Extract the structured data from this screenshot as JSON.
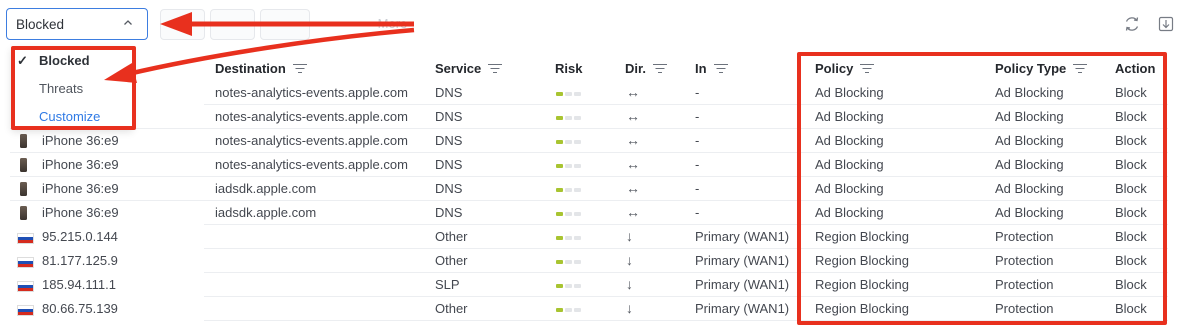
{
  "toolbar": {
    "filter_value": "Blocked",
    "ghost_text": "· · · · ·  · More ·",
    "icons": [
      "refresh-icon",
      "download-icon"
    ]
  },
  "dropdown": {
    "items": [
      {
        "label": "Blocked",
        "checked": true
      },
      {
        "label": "Threats",
        "checked": false
      },
      {
        "label": "Customize",
        "checked": false
      }
    ]
  },
  "columns": {
    "destination": "Destination",
    "service": "Service",
    "risk": "Risk",
    "dir": "Dir.",
    "in": "In",
    "policy": "Policy",
    "policy_type": "Policy Type",
    "action": "Action"
  },
  "rows": [
    {
      "source": "",
      "source_kind": "none",
      "destination": "notes-analytics-events.apple.com",
      "service": "DNS",
      "risk": 1,
      "dir": "↔",
      "in": "-",
      "policy": "Ad Blocking",
      "policy_type": "Ad Blocking",
      "action": "Block"
    },
    {
      "source": "",
      "source_kind": "none",
      "destination": "notes-analytics-events.apple.com",
      "service": "DNS",
      "risk": 1,
      "dir": "↔",
      "in": "-",
      "policy": "Ad Blocking",
      "policy_type": "Ad Blocking",
      "action": "Block"
    },
    {
      "source": "iPhone 36:e9",
      "source_kind": "device",
      "destination": "notes-analytics-events.apple.com",
      "service": "DNS",
      "risk": 1,
      "dir": "↔",
      "in": "-",
      "policy": "Ad Blocking",
      "policy_type": "Ad Blocking",
      "action": "Block"
    },
    {
      "source": "iPhone 36:e9",
      "source_kind": "device",
      "destination": "notes-analytics-events.apple.com",
      "service": "DNS",
      "risk": 1,
      "dir": "↔",
      "in": "-",
      "policy": "Ad Blocking",
      "policy_type": "Ad Blocking",
      "action": "Block"
    },
    {
      "source": "iPhone 36:e9",
      "source_kind": "device",
      "destination": "iadsdk.apple.com",
      "service": "DNS",
      "risk": 1,
      "dir": "↔",
      "in": "-",
      "policy": "Ad Blocking",
      "policy_type": "Ad Blocking",
      "action": "Block"
    },
    {
      "source": "iPhone 36:e9",
      "source_kind": "device",
      "destination": "iadsdk.apple.com",
      "service": "DNS",
      "risk": 1,
      "dir": "↔",
      "in": "-",
      "policy": "Ad Blocking",
      "policy_type": "Ad Blocking",
      "action": "Block"
    },
    {
      "source": "95.215.0.144",
      "source_kind": "flag-ru",
      "destination": "",
      "service": "Other",
      "risk": 1,
      "dir": "↓",
      "in": "Primary (WAN1)",
      "policy": "Region Blocking",
      "policy_type": "Protection",
      "action": "Block"
    },
    {
      "source": "81.177.125.9",
      "source_kind": "flag-ru",
      "destination": "",
      "service": "Other",
      "risk": 1,
      "dir": "↓",
      "in": "Primary (WAN1)",
      "policy": "Region Blocking",
      "policy_type": "Protection",
      "action": "Block"
    },
    {
      "source": "185.94.111.1",
      "source_kind": "flag-ru",
      "destination": "",
      "service": "SLP",
      "risk": 1,
      "dir": "↓",
      "in": "Primary (WAN1)",
      "policy": "Region Blocking",
      "policy_type": "Protection",
      "action": "Block"
    },
    {
      "source": "80.66.75.139",
      "source_kind": "flag-ru",
      "destination": "",
      "service": "Other",
      "risk": 1,
      "dir": "↓",
      "in": "Primary (WAN1)",
      "policy": "Region Blocking",
      "policy_type": "Protection",
      "action": "Block"
    }
  ],
  "colors": {
    "highlight": "#e8301e",
    "accent": "#3d7de0",
    "risk_low": "#a8c431",
    "risk_empty": "#e3e5e8"
  }
}
